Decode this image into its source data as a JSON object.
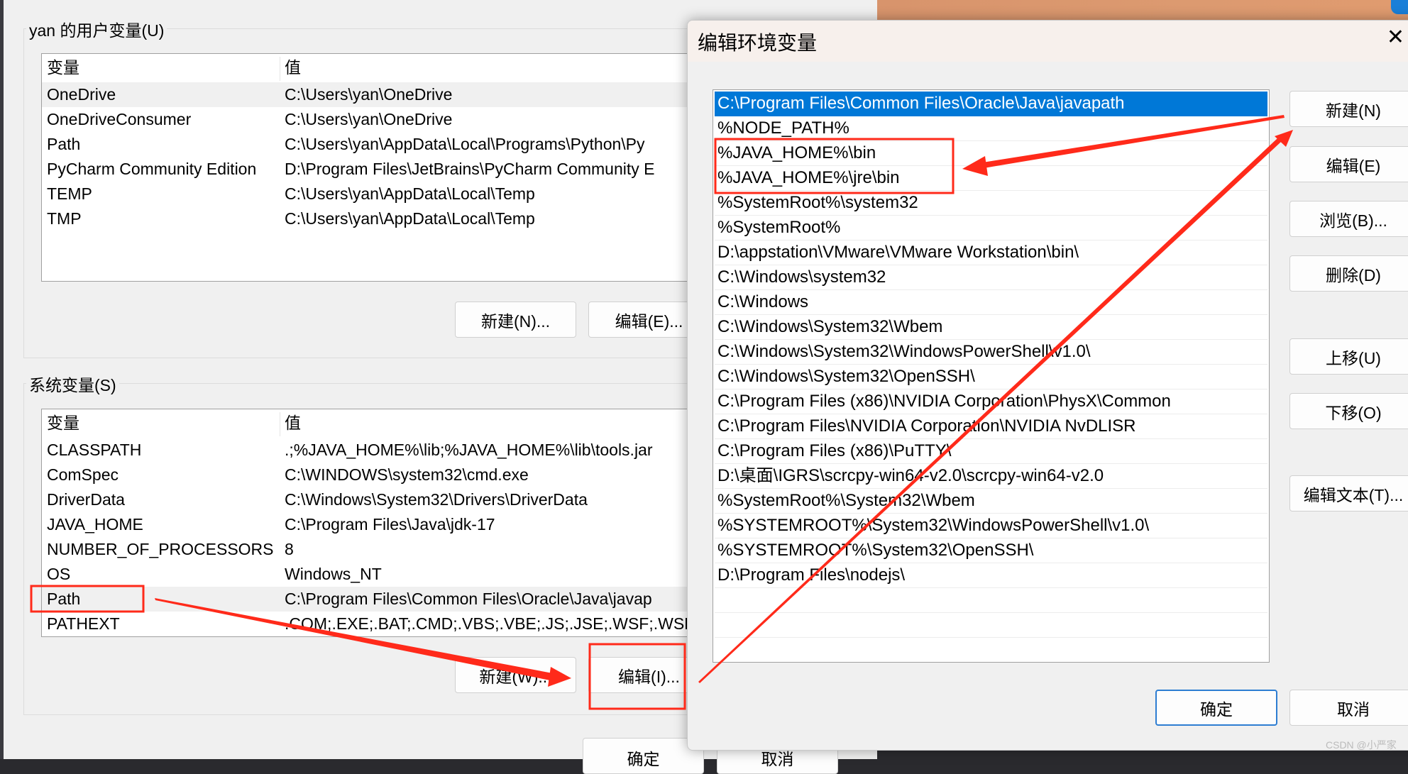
{
  "user_vars": {
    "group_label": "yan 的用户变量(U)",
    "headers": [
      "变量",
      "值"
    ],
    "rows": [
      [
        "OneDrive",
        "C:\\Users\\yan\\OneDrive"
      ],
      [
        "OneDriveConsumer",
        "C:\\Users\\yan\\OneDrive"
      ],
      [
        "Path",
        "C:\\Users\\yan\\AppData\\Local\\Programs\\Python\\Py"
      ],
      [
        "PyCharm Community Edition",
        "D:\\Program Files\\JetBrains\\PyCharm Community E"
      ],
      [
        "TEMP",
        "C:\\Users\\yan\\AppData\\Local\\Temp"
      ],
      [
        "TMP",
        "C:\\Users\\yan\\AppData\\Local\\Temp"
      ]
    ],
    "selected_index": 0,
    "new_button": "新建(N)...",
    "edit_button": "编辑(E)..."
  },
  "system_vars": {
    "group_label": "系统变量(S)",
    "headers": [
      "变量",
      "值"
    ],
    "rows": [
      [
        "CLASSPATH",
        ".;%JAVA_HOME%\\lib;%JAVA_HOME%\\lib\\tools.jar"
      ],
      [
        "ComSpec",
        "C:\\WINDOWS\\system32\\cmd.exe"
      ],
      [
        "DriverData",
        "C:\\Windows\\System32\\Drivers\\DriverData"
      ],
      [
        "JAVA_HOME",
        "C:\\Program Files\\Java\\jdk-17"
      ],
      [
        "NUMBER_OF_PROCESSORS",
        "8"
      ],
      [
        "OS",
        "Windows_NT"
      ],
      [
        "Path",
        "C:\\Program Files\\Common Files\\Oracle\\Java\\javap"
      ],
      [
        "PATHEXT",
        ".COM;.EXE;.BAT;.CMD;.VBS;.VBE;.JS;.JSE;.WSF;.WSH"
      ]
    ],
    "selected_index": 6,
    "new_button": "新建(W)...",
    "edit_button": "编辑(I)..."
  },
  "main_ok": "确定",
  "main_cancel": "取消",
  "edit_dialog": {
    "title": "编辑环境变量",
    "close_icon": "close-icon",
    "entries": [
      "C:\\Program Files\\Common Files\\Oracle\\Java\\javapath",
      "%NODE_PATH%",
      "%JAVA_HOME%\\bin",
      "%JAVA_HOME%\\jre\\bin",
      "%SystemRoot%\\system32",
      "%SystemRoot%",
      "D:\\appstation\\VMware\\VMware Workstation\\bin\\",
      "C:\\Windows\\system32",
      "C:\\Windows",
      "C:\\Windows\\System32\\Wbem",
      "C:\\Windows\\System32\\WindowsPowerShell\\v1.0\\",
      "C:\\Windows\\System32\\OpenSSH\\",
      "C:\\Program Files (x86)\\NVIDIA Corporation\\PhysX\\Common",
      "C:\\Program Files\\NVIDIA Corporation\\NVIDIA NvDLISR",
      "C:\\Program Files (x86)\\PuTTY\\",
      "D:\\桌面\\IGRS\\scrcpy-win64-v2.0\\scrcpy-win64-v2.0",
      "%SystemRoot%\\System32\\Wbem",
      "%SYSTEMROOT%\\System32\\WindowsPowerShell\\v1.0\\",
      "%SYSTEMROOT%\\System32\\OpenSSH\\",
      "D:\\Program Files\\nodejs\\"
    ],
    "selected_index": 0,
    "buttons": {
      "new": "新建(N)",
      "edit": "编辑(E)",
      "browse": "浏览(B)...",
      "delete": "删除(D)",
      "move_up": "上移(U)",
      "move_down": "下移(O)",
      "edit_text": "编辑文本(T)...",
      "ok": "确定",
      "cancel": "取消"
    }
  },
  "annotation_color": "#ff2a1a",
  "selection_color": "#0078d7",
  "watermark": "CSDN @小严家"
}
